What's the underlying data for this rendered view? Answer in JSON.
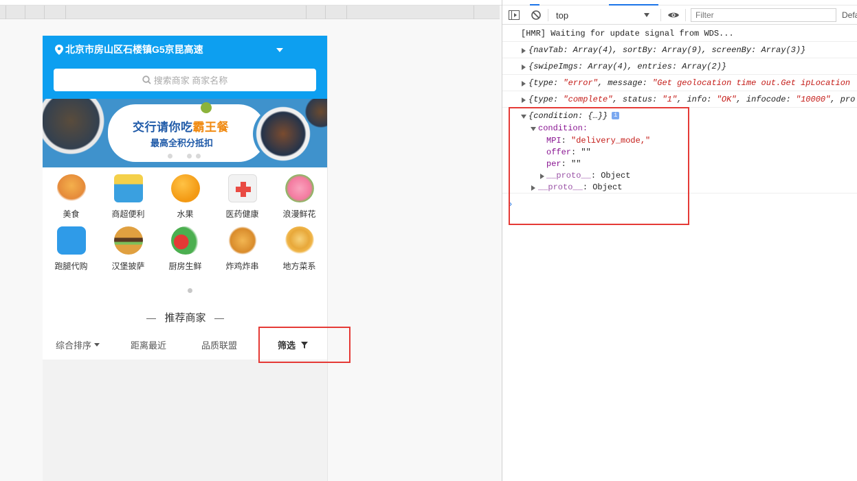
{
  "app": {
    "location": "北京市房山区石楼镇G5京昆高速",
    "search_placeholder": "搜索商家 商家名称",
    "banner": {
      "title_prefix": "交行请你吃",
      "title_highlight": "霸王餐",
      "subtitle": "最高全积分抵扣"
    },
    "categories": [
      {
        "label": "美食",
        "icon": "burger-food-icon",
        "color": "#e58a3a"
      },
      {
        "label": "商超便利",
        "icon": "supermarket-basket-icon",
        "color": "#3aa0e0"
      },
      {
        "label": "水果",
        "icon": "orange-fruit-icon",
        "color": "#f39a14"
      },
      {
        "label": "医药健康",
        "icon": "medical-kit-icon",
        "color": "#e94b43"
      },
      {
        "label": "浪漫鲜花",
        "icon": "rose-flower-icon",
        "color": "#f47aa0"
      },
      {
        "label": "跑腿代购",
        "icon": "errand-bag-icon",
        "color": "#2f9be8"
      },
      {
        "label": "汉堡披萨",
        "icon": "hamburger-icon",
        "color": "#d9822b"
      },
      {
        "label": "厨房生鲜",
        "icon": "vegetables-icon",
        "color": "#4caf50"
      },
      {
        "label": "炸鸡炸串",
        "icon": "fried-chicken-icon",
        "color": "#e6a23c"
      },
      {
        "label": "地方菜系",
        "icon": "noodle-bowl-icon",
        "color": "#f0b64a"
      }
    ],
    "recommend_title": "推荐商家",
    "sort": {
      "comprehensive": "综合排序",
      "distance": "距离最近",
      "quality": "品质联盟",
      "filter": "筛选"
    }
  },
  "devtools": {
    "context": "top",
    "filter_placeholder": "Filter",
    "levels_label": "Defa",
    "logs": {
      "hmr": "[HMR] Waiting for update signal from WDS...",
      "nav_tab": "{navTab: Array(4), sortBy: Array(9), screenBy: Array(3)}",
      "swipe": "{swipeImgs: Array(4), entries: Array(2)}",
      "geo_error": {
        "pre": "{type: ",
        "type_val": "\"error\"",
        "mid": ", message: ",
        "message_val": "\"Get geolocation time out.Get ipLocation"
      },
      "complete": {
        "pre": "{type: ",
        "type_val": "\"complete\"",
        "m1": ", status: ",
        "status_val": "\"1\"",
        "m2": ", info: ",
        "info_val": "\"OK\"",
        "m3": ", infocode: ",
        "infocode_val": "\"10000\"",
        "tail": ", pro"
      },
      "condition": {
        "summary": "{condition: {…}}",
        "key": "condition",
        "mpi_key": "MPI",
        "mpi_val": "\"delivery_mode,\"",
        "offer_key": "offer",
        "offer_val": "\"\"",
        "per_key": "per",
        "per_val": "\"\"",
        "proto_inner": "__proto__",
        "proto_inner_val": ": Object",
        "proto_outer": "__proto__",
        "proto_outer_val": ": Object"
      }
    },
    "prompt": "›"
  }
}
